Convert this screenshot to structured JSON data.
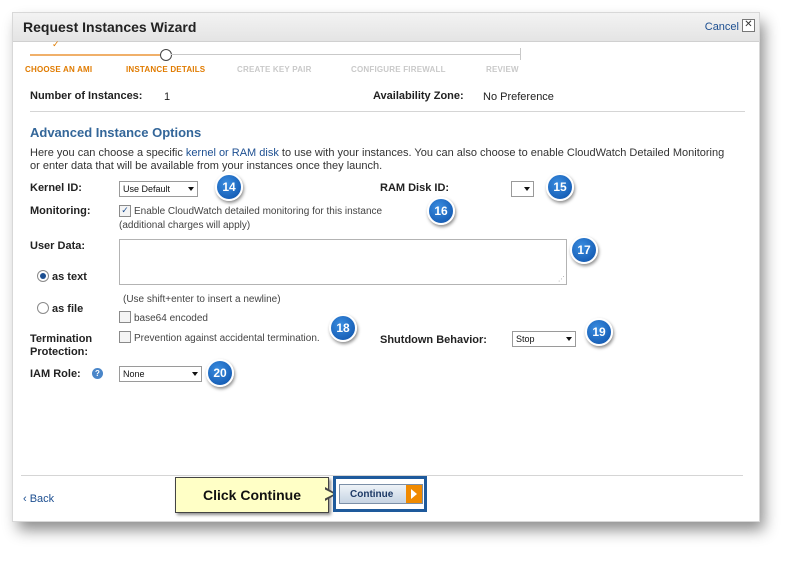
{
  "dialog": {
    "title": "Request Instances Wizard",
    "cancel_label": "Cancel",
    "close_glyph": "✕"
  },
  "steps": [
    {
      "label": "CHOOSE AN AMI",
      "state": "done"
    },
    {
      "label": "INSTANCE DETAILS",
      "state": "current"
    },
    {
      "label": "CREATE KEY PAIR",
      "state": "todo"
    },
    {
      "label": "CONFIGURE FIREWALL",
      "state": "todo"
    },
    {
      "label": "REVIEW",
      "state": "todo"
    }
  ],
  "summary": {
    "instances_label": "Number of Instances:",
    "instances_value": "1",
    "zone_label": "Availability Zone:",
    "zone_value": "No Preference"
  },
  "advanced": {
    "title": "Advanced Instance Options",
    "desc_before": "Here you can choose a specific ",
    "desc_link": "kernel or RAM disk",
    "desc_after": " to use with your instances. You can also choose to enable CloudWatch Detailed Monitoring or enter data that will be available from your instances once they launch.",
    "kernel_label": "Kernel ID:",
    "kernel_value": "Use Default",
    "ramdisk_label": "RAM Disk ID:",
    "ramdisk_value": "",
    "monitoring_label": "Monitoring:",
    "monitoring_text": "Enable CloudWatch detailed monitoring for this instance",
    "monitoring_charges": "(additional charges will apply)",
    "userdata_label": "User Data:",
    "as_text": "as text",
    "as_file": "as file",
    "userdata_hint": "(Use shift+enter to insert a newline)",
    "base64_label": "base64 encoded",
    "termination_label_1": "Termination",
    "termination_label_2": "Protection:",
    "termination_text": "Prevention against accidental termination.",
    "shutdown_label": "Shutdown Behavior:",
    "shutdown_value": "Stop",
    "iam_label": "IAM Role:",
    "iam_value": "None",
    "help_glyph": "?"
  },
  "badges": {
    "b14": "14",
    "b15": "15",
    "b16": "16",
    "b17": "17",
    "b18": "18",
    "b19": "19",
    "b20": "20"
  },
  "footer": {
    "back_label": "‹ Back",
    "callout_text": "Click Continue",
    "continue_label": "Continue"
  },
  "colors": {
    "accent": "#e07b00",
    "link": "#1d4f91",
    "heading": "#336699",
    "badge": "#0b4fa8",
    "callout_bg": "#ffffc6"
  }
}
